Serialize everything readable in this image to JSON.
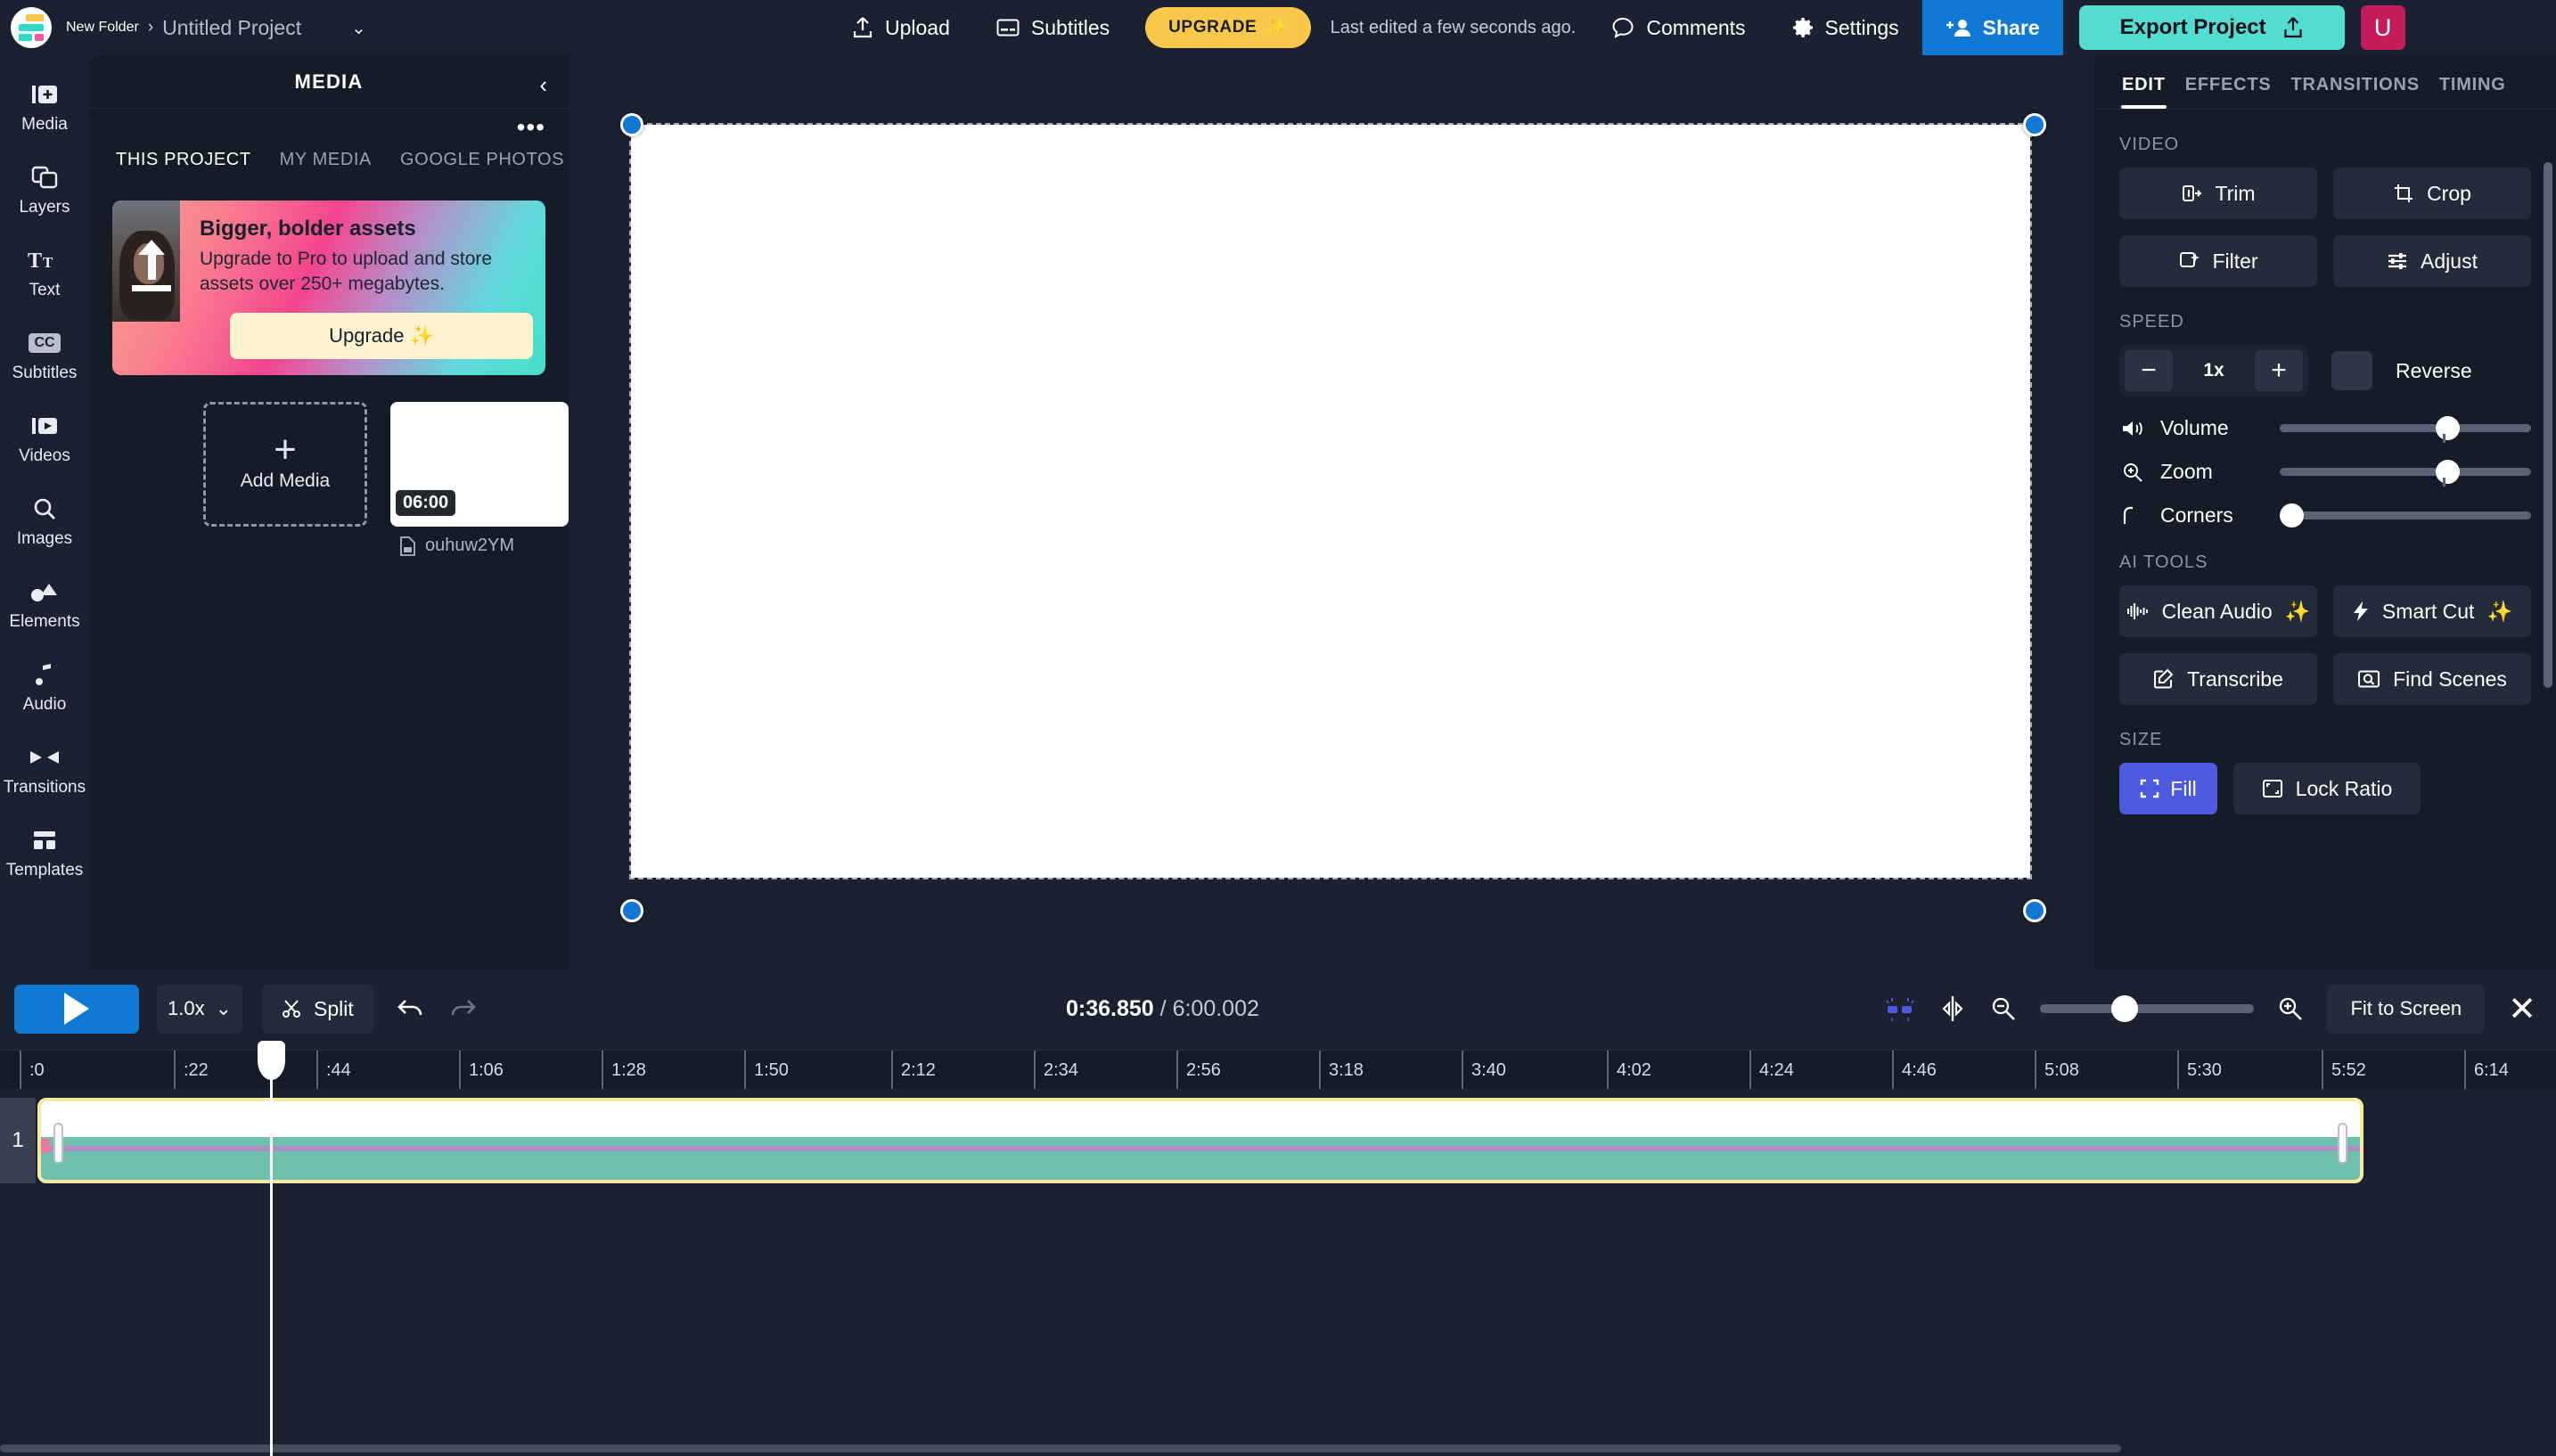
{
  "topbar": {
    "folder": "New Folder",
    "separator": "›",
    "project": "Untitled Project",
    "caret": "⌄",
    "upload": "Upload",
    "subtitles": "Subtitles",
    "upgrade": "UPGRADE",
    "upgrade_sparkle": "✨",
    "last_edited": "Last edited a few seconds ago.",
    "comments": "Comments",
    "settings": "Settings",
    "share": "Share",
    "export": "Export Project",
    "avatar_initial": "U",
    "colors": {
      "upgrade": "#f9c84b",
      "share": "#1179d4",
      "export": "#52ddd0",
      "avatar": "#c41d5c"
    }
  },
  "rail": {
    "items": [
      {
        "label": "Media",
        "icon": "media-add-icon"
      },
      {
        "label": "Layers",
        "icon": "layers-icon"
      },
      {
        "label": "Text",
        "icon": "text-icon"
      },
      {
        "label": "Subtitles",
        "icon": "cc-icon"
      },
      {
        "label": "Videos",
        "icon": "video-icon"
      },
      {
        "label": "Images",
        "icon": "search-image-icon"
      },
      {
        "label": "Elements",
        "icon": "shapes-icon"
      },
      {
        "label": "Audio",
        "icon": "music-note-icon"
      },
      {
        "label": "Transitions",
        "icon": "transitions-icon"
      },
      {
        "label": "Templates",
        "icon": "templates-icon"
      }
    ]
  },
  "media_panel": {
    "title": "MEDIA",
    "collapse": "‹",
    "more": "•••",
    "tabs": [
      {
        "label": "THIS PROJECT",
        "active": true
      },
      {
        "label": "MY MEDIA",
        "active": false
      },
      {
        "label": "GOOGLE PHOTOS",
        "active": false
      }
    ],
    "promo": {
      "title": "Bigger, bolder assets",
      "body": "Upgrade to Pro to upload and store assets over 250+ megabytes.",
      "cta": "Upgrade",
      "cta_sparkle": "✨"
    },
    "add_media": {
      "plus": "+",
      "label": "Add Media"
    },
    "asset": {
      "duration": "06:00",
      "name": "ouhuw2YM"
    }
  },
  "right_panel": {
    "tabs": [
      {
        "label": "EDIT",
        "active": true
      },
      {
        "label": "EFFECTS",
        "active": false
      },
      {
        "label": "TRANSITIONS",
        "active": false
      },
      {
        "label": "TIMING",
        "active": false
      }
    ],
    "video_label": "VIDEO",
    "video_buttons": [
      {
        "label": "Trim",
        "icon": "trim-icon"
      },
      {
        "label": "Crop",
        "icon": "crop-icon"
      },
      {
        "label": "Filter",
        "icon": "filter-icon"
      },
      {
        "label": "Adjust",
        "icon": "adjust-icon"
      }
    ],
    "speed_label": "SPEED",
    "speed_minus": "−",
    "speed_value": "1x",
    "speed_plus": "+",
    "reverse_label": "Reverse",
    "sliders": [
      {
        "name": "Volume",
        "icon": "volume-icon",
        "percent": 68
      },
      {
        "name": "Zoom",
        "icon": "zoom-icon",
        "percent": 68
      },
      {
        "name": "Corners",
        "icon": "corners-icon",
        "percent": 2
      }
    ],
    "ai_label": "AI TOOLS",
    "ai_buttons": [
      {
        "label": "Clean Audio",
        "sparkle": "✨",
        "icon": "waveform-icon"
      },
      {
        "label": "Smart Cut",
        "sparkle": "✨",
        "icon": "bolt-icon"
      },
      {
        "label": "Transcribe",
        "sparkle": "",
        "icon": "pencil-square-icon"
      },
      {
        "label": "Find Scenes",
        "sparkle": "",
        "icon": "scene-search-icon"
      }
    ],
    "size_label": "SIZE",
    "fill_label": "Fill",
    "lock_ratio_label": "Lock Ratio",
    "fill_color": "#4c5ae0"
  },
  "timeline": {
    "rate": "1.0x",
    "rate_caret": "⌄",
    "split": "Split",
    "current_time": "0:36.850",
    "time_divider": "/",
    "total_time": "6:00.002",
    "fit_to_screen": "Fit to Screen",
    "close": "✕",
    "track_number": "1",
    "ruler_ticks": [
      ":0",
      ":22",
      ":44",
      "1:06",
      "1:28",
      "1:50",
      "2:12",
      "2:34",
      "2:56",
      "3:18",
      "3:40",
      "4:02",
      "4:24",
      "4:46",
      "5:08",
      "5:30",
      "5:52",
      "6:14"
    ]
  }
}
